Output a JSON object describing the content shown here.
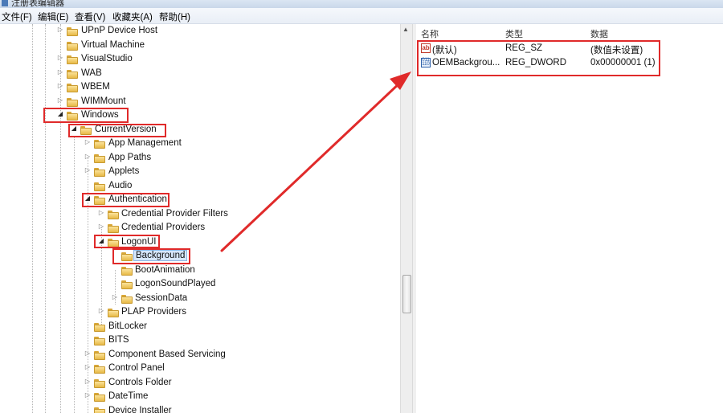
{
  "window": {
    "title": "注册表编辑器"
  },
  "menu": [
    {
      "label": "文件(F)"
    },
    {
      "label": "编辑(E)"
    },
    {
      "label": "查看(V)"
    },
    {
      "label": "收藏夹(A)"
    },
    {
      "label": "帮助(H)"
    }
  ],
  "tree": [
    {
      "label": "UPnP Device Host",
      "level": 0,
      "expander": "closed"
    },
    {
      "label": "Virtual Machine",
      "level": 0,
      "expander": "none"
    },
    {
      "label": "VisualStudio",
      "level": 0,
      "expander": "closed"
    },
    {
      "label": "WAB",
      "level": 0,
      "expander": "closed"
    },
    {
      "label": "WBEM",
      "level": 0,
      "expander": "closed"
    },
    {
      "label": "WIMMount",
      "level": 0,
      "expander": "closed"
    },
    {
      "label": "Windows",
      "level": 0,
      "expander": "open"
    },
    {
      "label": "CurrentVersion",
      "level": 1,
      "expander": "open"
    },
    {
      "label": "App Management",
      "level": 2,
      "expander": "closed"
    },
    {
      "label": "App Paths",
      "level": 2,
      "expander": "closed"
    },
    {
      "label": "Applets",
      "level": 2,
      "expander": "closed"
    },
    {
      "label": "Audio",
      "level": 2,
      "expander": "none"
    },
    {
      "label": "Authentication",
      "level": 2,
      "expander": "open"
    },
    {
      "label": "Credential Provider Filters",
      "level": 3,
      "expander": "closed"
    },
    {
      "label": "Credential Providers",
      "level": 3,
      "expander": "closed"
    },
    {
      "label": "LogonUI",
      "level": 3,
      "expander": "open"
    },
    {
      "label": "Background",
      "level": 4,
      "expander": "none",
      "selected": true
    },
    {
      "label": "BootAnimation",
      "level": 4,
      "expander": "none"
    },
    {
      "label": "LogonSoundPlayed",
      "level": 4,
      "expander": "none"
    },
    {
      "label": "SessionData",
      "level": 4,
      "expander": "closed"
    },
    {
      "label": "PLAP Providers",
      "level": 3,
      "expander": "closed"
    },
    {
      "label": "BitLocker",
      "level": 2,
      "expander": "none"
    },
    {
      "label": "BITS",
      "level": 2,
      "expander": "none"
    },
    {
      "label": "Component Based Servicing",
      "level": 2,
      "expander": "closed"
    },
    {
      "label": "Control Panel",
      "level": 2,
      "expander": "closed"
    },
    {
      "label": "Controls Folder",
      "level": 2,
      "expander": "closed"
    },
    {
      "label": "DateTime",
      "level": 2,
      "expander": "closed"
    },
    {
      "label": "Device Installer",
      "level": 2,
      "expander": "none"
    }
  ],
  "list": {
    "headers": {
      "name": "名称",
      "type": "类型",
      "data": "数据"
    },
    "rows": [
      {
        "name": "(默认)",
        "type": "REG_SZ",
        "data": "(数值未设置)",
        "icon": "string-value-icon"
      },
      {
        "name": "OEMBackgrou...",
        "type": "REG_DWORD",
        "data": "0x00000001 (1)",
        "icon": "binary-value-icon"
      }
    ]
  },
  "colors": {
    "annotation": "#e02a2a",
    "selection": "#d6e6fa"
  }
}
